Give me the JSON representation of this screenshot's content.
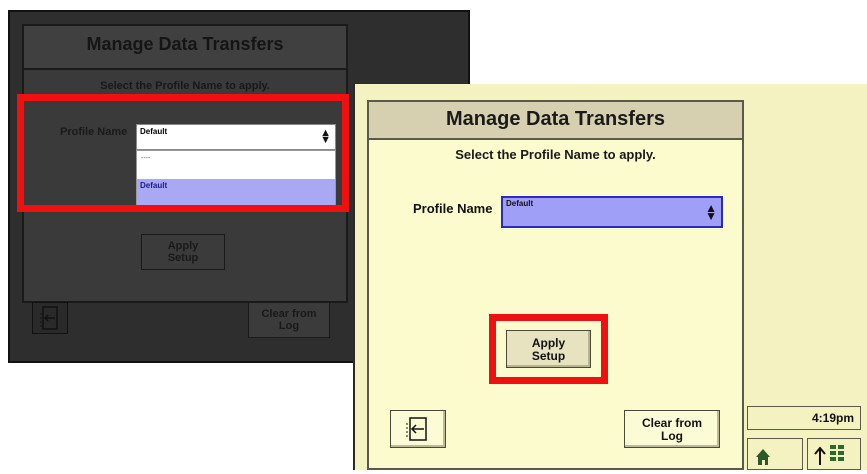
{
  "back_screen": {
    "title": "Manage Data Transfers",
    "subtitle": "Select the Profile Name to apply.",
    "profile_label": "Profile Name",
    "profile_value": "Default",
    "dropdown_options": [
      "----",
      "Default"
    ],
    "apply_button_label": "Apply\nSetup",
    "clear_button_label": "Clear from\nLog",
    "exit_icon": "exit-icon"
  },
  "front_screen": {
    "title": "Manage Data Transfers",
    "subtitle": "Select the Profile Name to apply.",
    "profile_label": "Profile Name",
    "profile_value": "Default",
    "apply_button_label": "Apply\nSetup",
    "clear_button_label": "Clear from\nLog",
    "clock": "4:19pm",
    "exit_icon": "exit-icon",
    "home_icon": "home-icon",
    "menu_icon": "menu-icon"
  },
  "colors": {
    "highlight_box": "#f01010",
    "front_background": "#fbfbce",
    "select_highlight": "#9f9ff8"
  }
}
